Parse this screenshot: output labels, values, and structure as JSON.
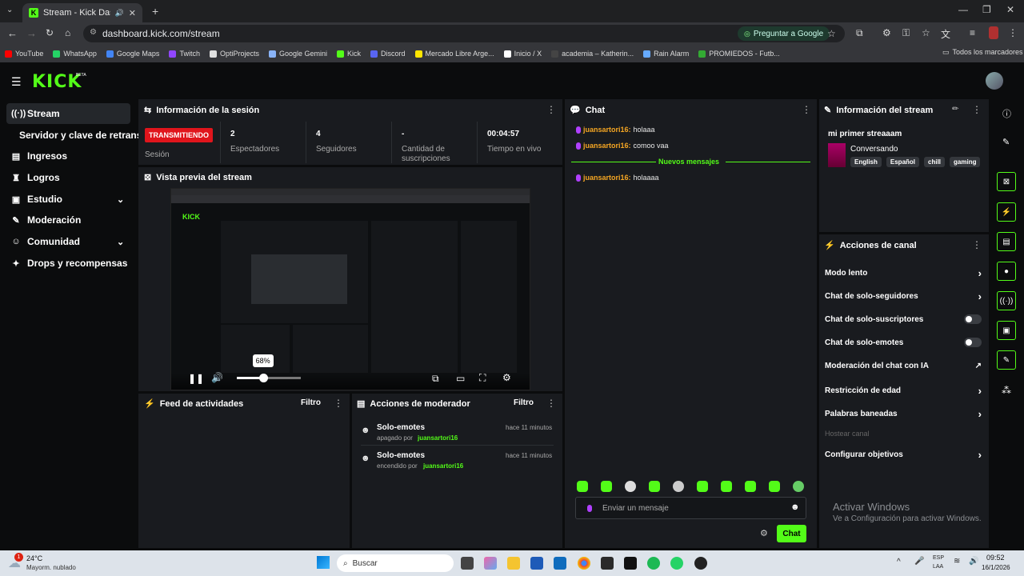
{
  "browser": {
    "tab_title": "Stream - Kick Dashboard",
    "url": "dashboard.kick.com/stream",
    "ask_button": "Preguntar a Google",
    "bookmarks": [
      {
        "label": "YouTube",
        "color": "#ff0000"
      },
      {
        "label": "WhatsApp",
        "color": "#25d366"
      },
      {
        "label": "Google Maps",
        "color": "#4285f4"
      },
      {
        "label": "Twitch",
        "color": "#9146ff"
      },
      {
        "label": "OptiProjects",
        "color": "#e0e0e0"
      },
      {
        "label": "Google Gemini",
        "color": "#8ab4f8"
      },
      {
        "label": "Kick",
        "color": "#53fc18"
      },
      {
        "label": "Discord",
        "color": "#5865f2"
      },
      {
        "label": "Mercado Libre Arge...",
        "color": "#ffe600"
      },
      {
        "label": "Inicio / X",
        "color": "#ffffff"
      },
      {
        "label": "academia – Katherin...",
        "color": "#444444"
      },
      {
        "label": "Rain Alarm",
        "color": "#66aaff"
      },
      {
        "label": "PROMIEDOS - Futb...",
        "color": "#33aa33"
      }
    ],
    "all_bookmarks": "Todos los marcadores"
  },
  "sidebar": {
    "logo": "KICK",
    "beta": "BETA",
    "items": [
      {
        "label": "Stream",
        "icon": "broadcast-icon"
      },
      {
        "label": "Servidor y clave de retransm",
        "icon": ""
      },
      {
        "label": "Ingresos",
        "icon": "revenue-icon"
      },
      {
        "label": "Logros",
        "icon": "trophy-icon"
      },
      {
        "label": "Estudio",
        "icon": "studio-icon"
      },
      {
        "label": "Moderación",
        "icon": "wrench-icon"
      },
      {
        "label": "Comunidad",
        "icon": "community-icon"
      },
      {
        "label": "Drops y recompensas",
        "icon": "gift-icon"
      }
    ]
  },
  "session": {
    "title": "Información de la sesión",
    "live_badge": "TRANSMITIENDO",
    "session_label": "Sesión",
    "stats": [
      {
        "value": "2",
        "label": "Espectadores"
      },
      {
        "value": "4",
        "label": "Seguidores"
      },
      {
        "value": "-",
        "label": "Cantidad de suscripciones"
      },
      {
        "value": "00:04:57",
        "label": "Tiempo en vivo"
      }
    ]
  },
  "preview": {
    "title": "Vista previa del stream",
    "volume_tooltip": "68%",
    "volume": 0.68
  },
  "feed": {
    "title": "Feed de actividades",
    "filter": "Filtro"
  },
  "modactions": {
    "title": "Acciones de moderador",
    "filter": "Filtro",
    "items": [
      {
        "title": "Solo-emotes",
        "action": "apagado por",
        "user": "juansartori16",
        "time": "hace 11 minutos"
      },
      {
        "title": "Solo-emotes",
        "action": "encendido por",
        "user": "juansartori16",
        "time": "hace 11 minutos"
      }
    ]
  },
  "chat": {
    "title": "Chat",
    "messages": [
      {
        "user": "juansartori16:",
        "text": "holaaa"
      },
      {
        "user": "juansartori16:",
        "text": "comoo vaa"
      }
    ],
    "new_label": "Nuevos mensajes",
    "new_messages": [
      {
        "user": "juansartori16:",
        "text": "holaaaa"
      }
    ],
    "placeholder": "Enviar un mensaje",
    "send": "Chat"
  },
  "stream_info": {
    "title": "Información del stream",
    "stream_title": "mi primer streaaam",
    "category": "Conversando",
    "tags": [
      "English",
      "Español",
      "chill",
      "gaming"
    ]
  },
  "channel_actions": {
    "title": "Acciones de canal",
    "items": [
      {
        "label": "Modo lento",
        "control": "chevron"
      },
      {
        "label": "Chat de solo-seguidores",
        "control": "chevron"
      },
      {
        "label": "Chat de solo-suscriptores",
        "control": "toggle"
      },
      {
        "label": "Chat de solo-emotes",
        "control": "toggle"
      },
      {
        "label": "Moderación del chat con IA",
        "control": "external"
      },
      {
        "label": "Restricción de edad",
        "control": "chevron"
      },
      {
        "label": "Palabras baneadas",
        "control": "chevron"
      },
      {
        "label": "Hostear canal",
        "control": "disabled"
      },
      {
        "label": "Configurar objetivos",
        "control": "chevron"
      }
    ]
  },
  "watermark": {
    "line1": "Activar Windows",
    "line2": "Ve a Configuración para activar Windows."
  },
  "taskbar": {
    "temp": "24°C",
    "weather": "Mayorm. nublado",
    "badge": "1",
    "search": "Buscar",
    "lang1": "ESP",
    "lang2": "LAA",
    "time": "09:52",
    "date": "16/1/2026"
  }
}
